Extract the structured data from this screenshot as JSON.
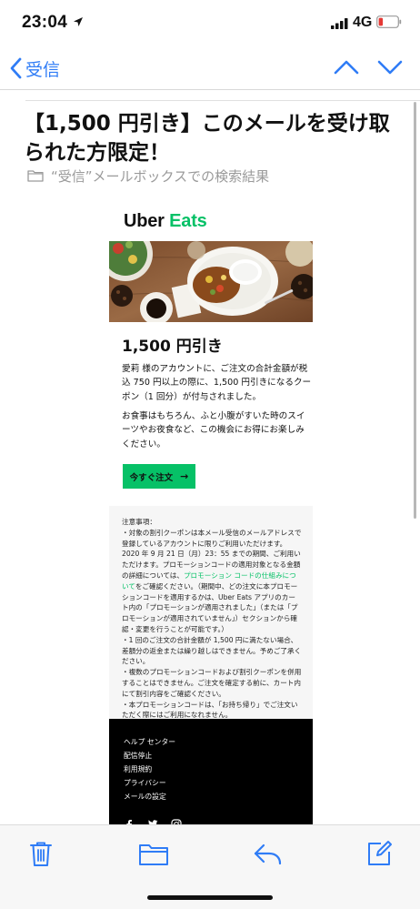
{
  "status_bar": {
    "time": "23:04",
    "network": "4G",
    "battery_color": "#e53935"
  },
  "nav": {
    "back_label": "受信",
    "accent": "#2f7cf6"
  },
  "message": {
    "subject": "【1,500 円引き】このメールを受け取られた方限定！",
    "mailbox": "“受信”メールボックスでの検索結果"
  },
  "email": {
    "logo_uber": "Uber",
    "logo_eats": "Eats",
    "brand_color": "#06c167",
    "heading": "1,500 円引き",
    "paragraph1": "愛莉 様のアカウントに、ご注文の合計金額が税込 750 円以上の際に、1,500 円引きになるクーポン（1 回分）が付与されました。",
    "paragraph2": "お食事はもちろん、ふと小腹がすいた時のスイーツやお夜食など、この機会にお得にお楽しみください。",
    "cta_label": "今すぐ注文"
  },
  "notes": {
    "title": "注意事項：",
    "item1_a": "・対象の割引クーポンは本メール受信のメールアドレスで登録しているアカウントに限りご利用いただけます。2020 年 9 月 21 日（月）23：55 までの期間、ご利用いただけます。プロモーションコードの適用対象となる金額の詳細については、",
    "item1_link": "プロモーション コードの仕組みについて",
    "item1_b": "をご確認ください。（期間中、どの注文に本プロモーションコードを適用するかは、Uber Eats アプリのカート内の「プロモーションが適用されました」（または「プロモーションが適用されていません」）セクションから確認・変更を行うことが可能です。）",
    "item2": "・1 回のご注文の合計金額が 1,500 円に満たない場合、差額分の返金または繰り越しはできません。予めご了承ください。",
    "item3": "・複数のプロモーションコードおよび割引クーポンを併用することはできません。ご注文を確定する前に、カート内にて割引内容をご確認ください。",
    "item4": "・本プロモーションコードは、「お持ち帰り」でご注文いただく際にはご利用になれません。"
  },
  "footer": {
    "links": [
      "ヘルプ センター",
      "配信停止",
      "利用規約",
      "プライバシー",
      "メールの設定"
    ],
    "social": [
      "facebook-icon",
      "twitter-icon",
      "instagram-icon"
    ]
  },
  "toolbar": {
    "icons": [
      "trash-icon",
      "folder-icon",
      "reply-icon",
      "compose-icon"
    ],
    "tint": "#2f7cf6"
  }
}
